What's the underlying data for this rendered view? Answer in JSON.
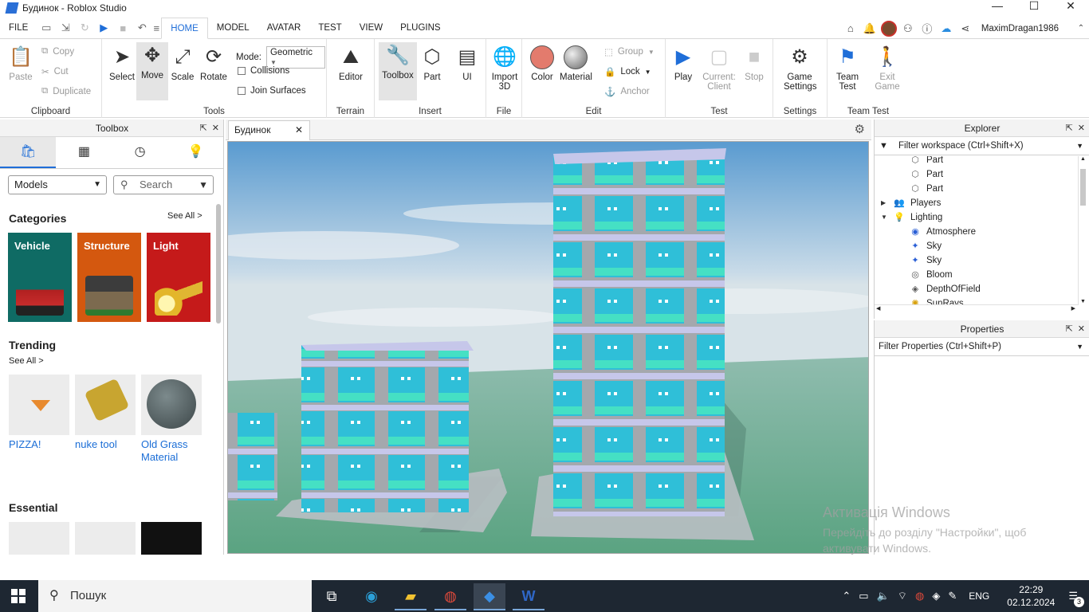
{
  "window": {
    "title": "Будинок - Roblox Studio",
    "controls": [
      "—",
      "☐",
      "✕"
    ]
  },
  "menu": {
    "file": "FILE",
    "tabs": [
      "HOME",
      "MODEL",
      "AVATAR",
      "TEST",
      "VIEW",
      "PLUGINS"
    ],
    "active_tab": "HOME",
    "username": "MaximDragan1986"
  },
  "ribbon": {
    "clipboard": {
      "paste": "Paste",
      "copy": "Copy",
      "cut": "Cut",
      "duplicate": "Duplicate",
      "label": "Clipboard"
    },
    "tools": {
      "select": "Select",
      "move": "Move",
      "scale": "Scale",
      "rotate": "Rotate",
      "mode_label": "Mode:",
      "mode_value": "Geometric",
      "collisions": "Collisions",
      "join_surfaces": "Join Surfaces",
      "label": "Tools"
    },
    "terrain": {
      "editor": "Editor",
      "label": "Terrain"
    },
    "insert": {
      "toolbox": "Toolbox",
      "part": "Part",
      "ui": "UI",
      "label": "Insert"
    },
    "file": {
      "import3d_1": "Import",
      "import3d_2": "3D",
      "label": "File"
    },
    "edit": {
      "color": "Color",
      "material": "Material",
      "group": "Group",
      "lock": "Lock",
      "anchor": "Anchor",
      "label": "Edit"
    },
    "test": {
      "play": "Play",
      "current_1": "Current:",
      "current_2": "Client",
      "stop": "Stop",
      "label": "Test"
    },
    "settings": {
      "game_1": "Game",
      "game_2": "Settings",
      "label": "Settings"
    },
    "team_test": {
      "team_1": "Team",
      "team_2": "Test",
      "exit_1": "Exit",
      "exit_2": "Game",
      "label": "Team Test"
    }
  },
  "toolbox": {
    "title": "Toolbox",
    "category_select": "Models",
    "search_placeholder": "Search",
    "categories_title": "Categories",
    "see_all": "See All >",
    "categories": [
      {
        "label": "Vehicle",
        "color": "#0f6b64"
      },
      {
        "label": "Structure",
        "color": "#d4580f"
      },
      {
        "label": "Light",
        "color": "#c51a1a"
      }
    ],
    "trending_title": "Trending",
    "trending_see_all": "See All >",
    "trending": [
      {
        "name": "PIZZA!"
      },
      {
        "name": "nuke tool"
      },
      {
        "name": "Old Grass Material"
      }
    ],
    "essential_title": "Essential"
  },
  "document": {
    "tab": "Будинок"
  },
  "explorer": {
    "title": "Explorer",
    "filter": "Filter workspace (Ctrl+Shift+X)",
    "items": [
      {
        "label": "Part",
        "icon": "part-icon",
        "indent": 2,
        "arrow": ""
      },
      {
        "label": "Part",
        "icon": "part-icon",
        "indent": 2,
        "arrow": ""
      },
      {
        "label": "Part",
        "icon": "part-icon",
        "indent": 2,
        "arrow": ""
      },
      {
        "label": "Players",
        "icon": "players-icon",
        "indent": 1,
        "arrow": "▶"
      },
      {
        "label": "Lighting",
        "icon": "lighting-icon",
        "indent": 1,
        "arrow": "▼"
      },
      {
        "label": "Atmosphere",
        "icon": "atmosphere-icon",
        "indent": 2,
        "arrow": ""
      },
      {
        "label": "Sky",
        "icon": "sky-icon",
        "indent": 2,
        "arrow": ""
      },
      {
        "label": "Sky",
        "icon": "sky-icon",
        "indent": 2,
        "arrow": ""
      },
      {
        "label": "Bloom",
        "icon": "bloom-icon",
        "indent": 2,
        "arrow": ""
      },
      {
        "label": "DepthOfField",
        "icon": "depth-of-field-icon",
        "indent": 2,
        "arrow": ""
      },
      {
        "label": "SunRays",
        "icon": "sunrays-icon",
        "indent": 2,
        "arrow": ""
      }
    ]
  },
  "properties": {
    "title": "Properties",
    "filter": "Filter Properties (Ctrl+Shift+P)"
  },
  "activation": {
    "line1": "Активація Windows",
    "line2": "Перейдіть до розділу \"Настройки\", щоб",
    "line3": "активувати Windows."
  },
  "taskbar": {
    "search_placeholder": "Пошук",
    "language": "ENG",
    "time": "22:29",
    "date": "02.12.2024",
    "notifications": "3"
  }
}
